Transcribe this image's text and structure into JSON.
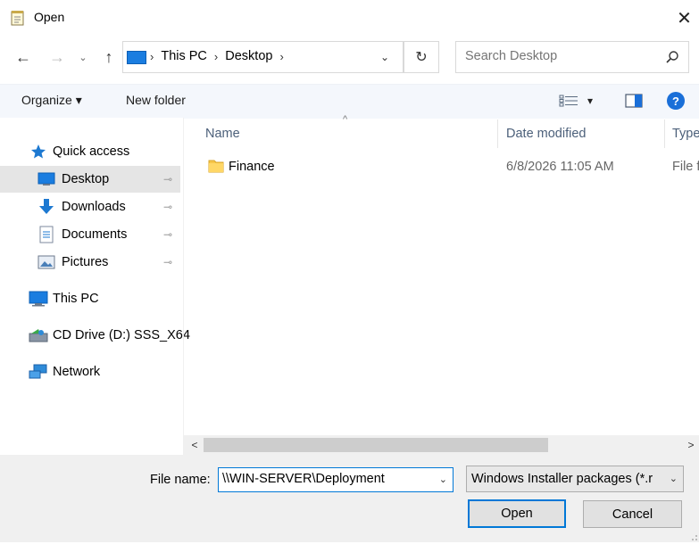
{
  "window": {
    "title": "Open",
    "close_glyph": "✕"
  },
  "nav": {
    "back_glyph": "←",
    "forward_glyph": "→",
    "recent_glyph": "⌄",
    "up_glyph": "↑",
    "breadcrumbs": [
      "This PC",
      "Desktop"
    ],
    "crumb_sep": "›",
    "refresh_glyph": "↻",
    "search_placeholder": "Search Desktop"
  },
  "toolbar": {
    "organize_label": "Organize ▾",
    "newfolder_label": "New folder",
    "view_arrow": "▾",
    "help_label": "?"
  },
  "sidebar": {
    "items": [
      {
        "label": "Quick access",
        "icon": "star-icon"
      },
      {
        "label": "Desktop",
        "icon": "desktop-icon",
        "pinned": true
      },
      {
        "label": "Downloads",
        "icon": "download-icon",
        "pinned": true
      },
      {
        "label": "Documents",
        "icon": "documents-icon",
        "pinned": true
      },
      {
        "label": "Pictures",
        "icon": "pictures-icon",
        "pinned": true
      },
      {
        "label": "This PC",
        "icon": "computer-icon"
      },
      {
        "label": "CD Drive (D:) SSS_X64",
        "icon": "cd-drive-icon"
      },
      {
        "label": "Network",
        "icon": "network-icon"
      }
    ],
    "pin_glyph": "📌"
  },
  "filelist": {
    "columns": [
      "Name",
      "Date modified",
      "Type"
    ],
    "sort_glyph": "^",
    "rows": [
      {
        "name": "Finance",
        "date": "6/8/2026 11:05 AM",
        "type": "File f"
      }
    ]
  },
  "scroll": {
    "left_glyph": "<",
    "right_glyph": ">"
  },
  "footer": {
    "filename_label": "File name:",
    "filename_value": "\\\\WIN-SERVER\\Deployment",
    "filetype_value": "Windows Installer packages (*.r",
    "drop_glyph": "⌄",
    "open_label": "Open",
    "cancel_label": "Cancel"
  },
  "colors": {
    "accent": "#0078d7",
    "selection": "#e5e5e5",
    "folder": "#f7c64a",
    "help": "#1a6fd8"
  }
}
